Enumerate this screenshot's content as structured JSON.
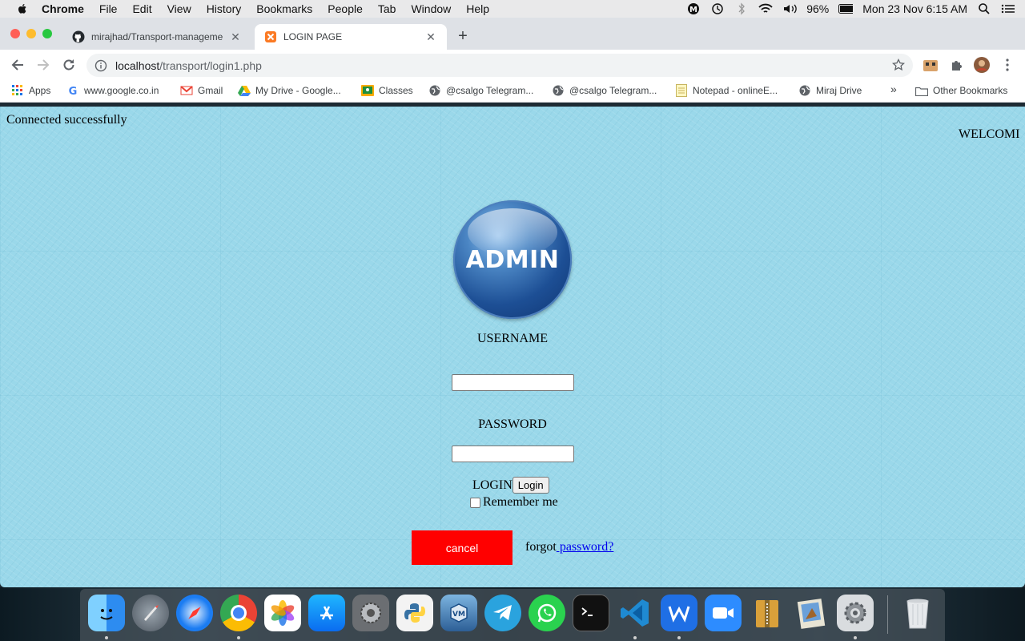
{
  "menubar": {
    "app": "Chrome",
    "items": [
      "File",
      "Edit",
      "View",
      "History",
      "Bookmarks",
      "People",
      "Tab",
      "Window",
      "Help"
    ],
    "battery": "96%",
    "datetime": "Mon 23 Nov  6:15 AM"
  },
  "tabs": [
    {
      "title": "mirajhad/Transport-manageme",
      "favicon": "github-icon"
    },
    {
      "title": "LOGIN PAGE",
      "favicon": "xampp-icon"
    }
  ],
  "address": {
    "host": "localhost",
    "path": "/transport/login1.php"
  },
  "bookmarks": [
    {
      "label": "Apps",
      "icon": "apps-grid-icon"
    },
    {
      "label": "www.google.co.in",
      "icon": "google-icon"
    },
    {
      "label": "Gmail",
      "icon": "gmail-icon"
    },
    {
      "label": "My Drive - Google...",
      "icon": "drive-icon"
    },
    {
      "label": "Classes",
      "icon": "classroom-icon"
    },
    {
      "label": "@csalgo Telegram...",
      "icon": "globe-icon"
    },
    {
      "label": "@csalgo Telegram...",
      "icon": "globe-icon"
    },
    {
      "label": "Notepad - onlineE...",
      "icon": "notepad-icon"
    },
    {
      "label": "Miraj Drive",
      "icon": "globe-icon"
    },
    {
      "label": "»",
      "icon": ""
    },
    {
      "label": "Other Bookmarks",
      "icon": "folder-icon"
    }
  ],
  "page": {
    "status": "Connected successfully",
    "marquee": "WELCOMI",
    "logo_text": "ADMIN",
    "username_label": "USERNAME",
    "username_value": "",
    "password_label": "PASSWORD",
    "password_value": "",
    "login_label": "LOGIN",
    "login_button": "Login",
    "remember": "Remember me",
    "cancel": "cancel",
    "forgot_prefix": "forgot",
    "forgot_link": " password?"
  },
  "dock": [
    "Finder",
    "Launchpad",
    "Safari",
    "Chrome",
    "Photos",
    "App Store",
    "System Preferences",
    "Python",
    "VirtualBox",
    "Telegram",
    "WhatsApp",
    "Terminal",
    "VS Code",
    "Writer",
    "Zoom",
    "Archive Utility",
    "Preview",
    "Settings",
    "Trash"
  ]
}
